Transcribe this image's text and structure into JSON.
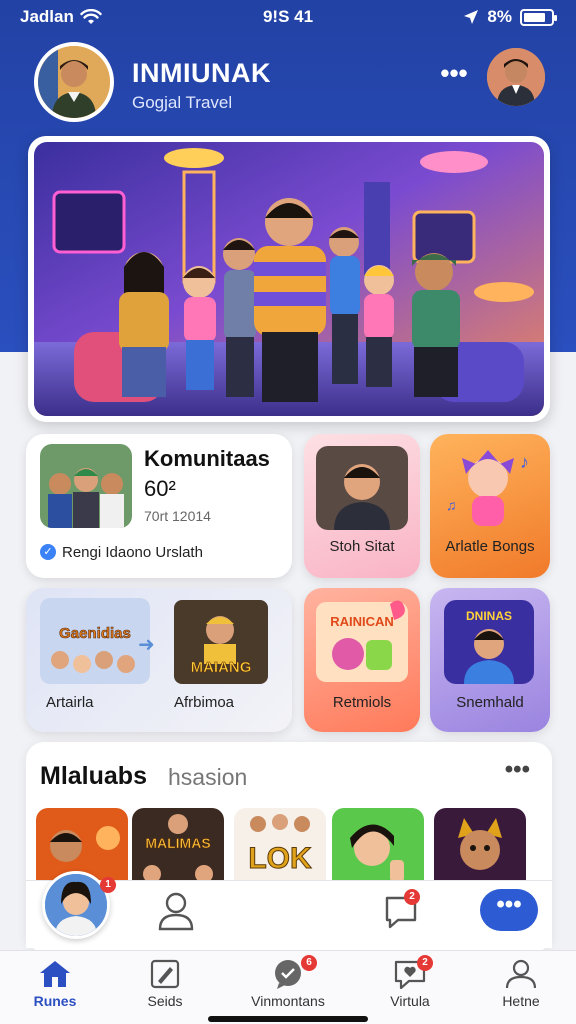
{
  "status_bar": {
    "carrier": "Jadlan",
    "time": "9!S 41",
    "battery": "8%",
    "battery_level": 0.8
  },
  "header": {
    "title": "INMIUNAK",
    "subtitle": "Gogjal Travel"
  },
  "community_card": {
    "title": "Komunitaas",
    "count": "60²",
    "date": "70rt 12014",
    "verified_text": "Rengi Idaono Urslath"
  },
  "tiles_row1": [
    {
      "label": "Stoh Sitat"
    },
    {
      "label": "Arlatle Bongs"
    }
  ],
  "tiles_row2": [
    {
      "label": "Artairla",
      "poster_text": "Gaenidias"
    },
    {
      "label": "Afrbimoa",
      "poster_text": "MAIANG"
    },
    {
      "label": "Retmiols",
      "poster_text": "RAINICAN"
    },
    {
      "label": "Snemhald",
      "poster_text": "DNINAS"
    }
  ],
  "section": {
    "title": "Mlaluabs",
    "subtitle": "hsasion",
    "thumbnails": [
      {
        "name": "fire-hero",
        "text": ""
      },
      {
        "name": "malimas",
        "text": "MALIMAS"
      },
      {
        "name": "lok",
        "text": "LOK"
      },
      {
        "name": "girl",
        "text": ""
      },
      {
        "name": "cat",
        "text": ""
      }
    ]
  },
  "action_bar": {
    "badge_avatar": "1",
    "badge_chat": "2"
  },
  "bottom_nav": [
    {
      "label": "Runes",
      "icon": "home-icon",
      "active": true
    },
    {
      "label": "Seids",
      "icon": "edit-icon",
      "active": false
    },
    {
      "label": "Vinmontans",
      "icon": "chat-icon",
      "active": false,
      "badge": "6"
    },
    {
      "label": "Virtula",
      "icon": "heart-chat-icon",
      "active": false,
      "badge": "2"
    },
    {
      "label": "Hetne",
      "icon": "profile-icon",
      "active": false
    }
  ],
  "colors": {
    "primary": "#2342a5",
    "accent": "#2c5bd3",
    "badge": "#e53935"
  }
}
